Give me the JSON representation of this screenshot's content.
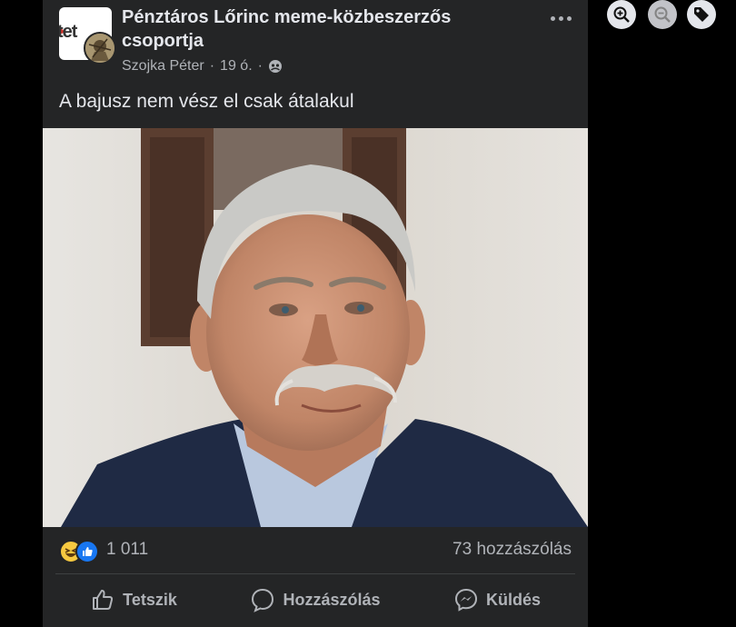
{
  "post": {
    "group_name": "Pénztáros Lőrinc meme-közbeszerzős csoportja",
    "group_logo_text": "tet",
    "author": "Szojka Péter",
    "time": "19 ó.",
    "separator": "·",
    "audience_icon": "group-audience-icon",
    "text": "A bajusz nem vész el csak átalakul",
    "photo_icon": "portrait-photo"
  },
  "stats": {
    "reaction_icons": [
      "haha-reaction-icon",
      "like-reaction-icon"
    ],
    "reaction_count": "1 011",
    "comment_count": "73 hozzászólás"
  },
  "actions": {
    "like_label": "Tetszik",
    "comment_label": "Hozzászólás",
    "send_label": "Küldés"
  },
  "viewer_tools": [
    "zoom-in-icon",
    "zoom-out-icon",
    "tag-icon"
  ],
  "colors": {
    "background": "#000000",
    "card": "#242526",
    "text_primary": "#e4e6eb",
    "text_secondary": "#b0b3b8",
    "like_blue": "#1877f2",
    "haha_yellow": "#f7c940"
  }
}
